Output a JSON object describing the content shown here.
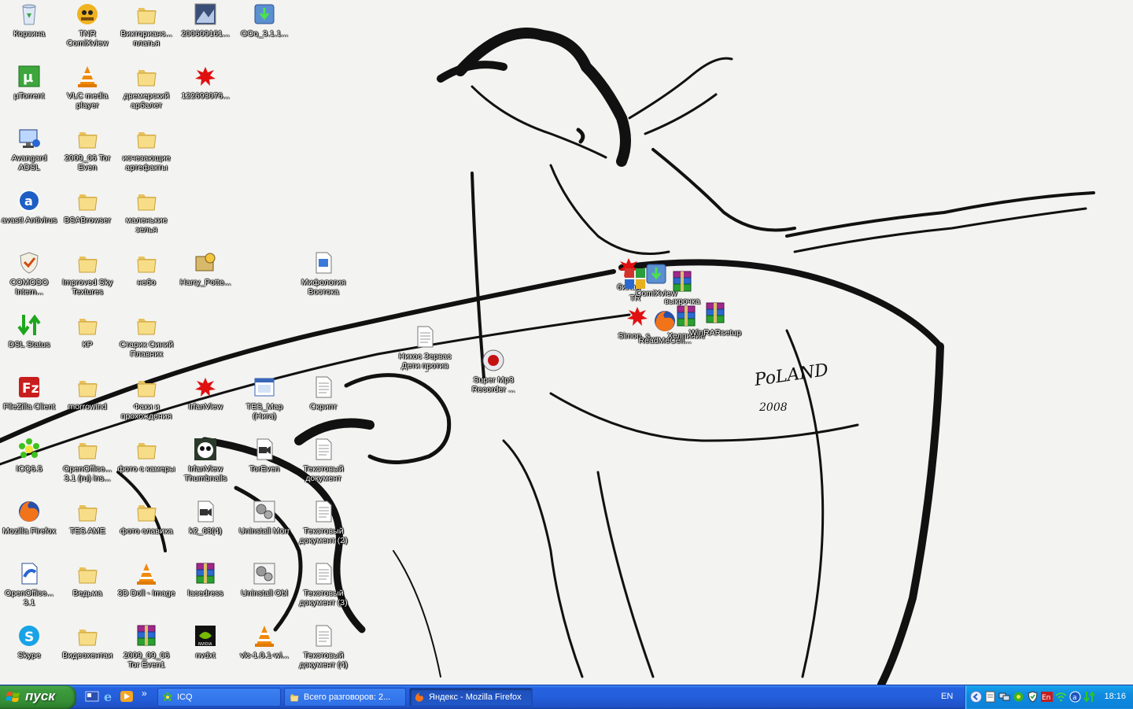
{
  "desktop_icons": [
    {
      "label": "Корзина",
      "icon": "recycle-bin-icon"
    },
    {
      "label": "TNR ComiXview",
      "icon": "comixview-icon"
    },
    {
      "label": "Викторианс... платья",
      "icon": "folder-icon"
    },
    {
      "label": "200609161...",
      "icon": "image-file-icon"
    },
    {
      "label": "OOo_3.1.1...",
      "icon": "installer-icon"
    },
    {
      "label": "µTorrent",
      "icon": "utorrent-icon"
    },
    {
      "label": "VLC media player",
      "icon": "vlc-icon"
    },
    {
      "label": "двемерский арбалет",
      "icon": "folder-icon"
    },
    {
      "label": "122693076...",
      "icon": "red-splat-icon"
    },
    {
      "label": "Avangard ADSL",
      "icon": "network-icon"
    },
    {
      "label": "2009_06 Tor Even",
      "icon": "folder-icon"
    },
    {
      "label": "исчезающие артефакты",
      "icon": "folder-icon"
    },
    {
      "label": "avast! Antivirus",
      "icon": "avast-icon"
    },
    {
      "label": "BSABrowser",
      "icon": "folder-icon"
    },
    {
      "label": "маленькие зелья",
      "icon": "folder-icon"
    },
    {
      "label": "COMODO Intern...",
      "icon": "comodo-icon"
    },
    {
      "label": "Improved Sky Textures",
      "icon": "folder-icon"
    },
    {
      "label": "небо",
      "icon": "folder-icon"
    },
    {
      "label": "Harry_Potte...",
      "icon": "setup-icon"
    },
    {
      "label": "Мифология Востока",
      "icon": "document-icon"
    },
    {
      "label": "DSL Status",
      "icon": "dsl-status-icon"
    },
    {
      "label": "КР",
      "icon": "folder-icon"
    },
    {
      "label": "Старик Синий Плавник",
      "icon": "folder-icon"
    },
    {
      "label": "Никос Зервас Дети против волшебников",
      "icon": "text-file-icon"
    },
    {
      "label": "Super Mp3 Recorder ...",
      "icon": "recorder-icon"
    },
    {
      "label": "FileZilla Client",
      "icon": "filezilla-icon"
    },
    {
      "label": "morrowind",
      "icon": "folder-icon"
    },
    {
      "label": "Факи и прохождения",
      "icon": "folder-icon"
    },
    {
      "label": "IrfanView",
      "icon": "red-splat-icon"
    },
    {
      "label": "TES_Map (Нига)",
      "icon": "window-icon"
    },
    {
      "label": "Скрипт",
      "icon": "text-file-icon"
    },
    {
      "label": "ICQ6.5",
      "icon": "icq-icon"
    },
    {
      "label": "OpenOffice... 3.1 (ru) ins...",
      "icon": "folder-icon"
    },
    {
      "label": "фото с камеры",
      "icon": "folder-icon"
    },
    {
      "label": "IrfanView Thumbnails",
      "icon": "panda-icon"
    },
    {
      "label": "TorEven",
      "icon": "video-file-icon"
    },
    {
      "label": "Текстовый документ",
      "icon": "text-file-icon"
    },
    {
      "label": "Mozilla Firefox",
      "icon": "firefox-icon"
    },
    {
      "label": "TES AME",
      "icon": "folder-icon"
    },
    {
      "label": "фото славика",
      "icon": "folder-icon"
    },
    {
      "label": "k2_68(4)",
      "icon": "video-file-icon"
    },
    {
      "label": "Uninstall Morr",
      "icon": "gears-icon"
    },
    {
      "label": "Текстовый документ (2)",
      "icon": "text-file-icon"
    },
    {
      "label": "OpenOffice... 3.1",
      "icon": "openoffice-icon"
    },
    {
      "label": "Ведьма",
      "icon": "folder-icon"
    },
    {
      "label": "3D Doll - Image",
      "icon": "vlc-icon"
    },
    {
      "label": "lacedress",
      "icon": "winrar-icon"
    },
    {
      "label": "Uninstall Obl",
      "icon": "gears-icon"
    },
    {
      "label": "Текстовый документ (3)",
      "icon": "text-file-icon"
    },
    {
      "label": "Skype",
      "icon": "skype-icon"
    },
    {
      "label": "Видеохентаи",
      "icon": "folder-icon"
    },
    {
      "label": "2009_09_06 Tor Even1",
      "icon": "winrar-icon"
    },
    {
      "label": "nvdxt",
      "icon": "nvidia-icon"
    },
    {
      "label": "vlc-1.0.1-wi...",
      "icon": "vlc-icon"
    },
    {
      "label": "Текстовый документ (4)",
      "icon": "text-file-icon"
    },
    {
      "label": "билан",
      "icon": "red-splat-icon"
    },
    {
      "label": "TR",
      "icon": "multi-icon"
    },
    {
      "label": "ComiXview",
      "icon": "installer-icon"
    },
    {
      "label": "выкрочка",
      "icon": "winrar-icon"
    },
    {
      "label": "Simon_s...",
      "icon": "red-splat-icon"
    },
    {
      "label": "ReadMeCelt...",
      "icon": "firefox-icon"
    },
    {
      "label": "Хелпиние",
      "icon": "winrar-icon"
    },
    {
      "label": "WinRARsetup",
      "icon": "winrar-icon"
    }
  ],
  "taskbar": {
    "start_label": "пуск",
    "quick_launch": [
      "show-desktop-icon",
      "ie-icon",
      "media-player-icon"
    ],
    "overflow": "»",
    "tasks": [
      {
        "label": "ICQ",
        "icon": "icq-icon"
      },
      {
        "label": "Всего разговоров: 2...",
        "icon": "folder-icon"
      },
      {
        "label": "Яндекс - Mozilla Firefox",
        "icon": "firefox-icon"
      }
    ],
    "language": "EN",
    "tray_language": "En",
    "clock": "18:16"
  },
  "wallpaper": {
    "signature": "PoLAND",
    "year": "2008"
  }
}
